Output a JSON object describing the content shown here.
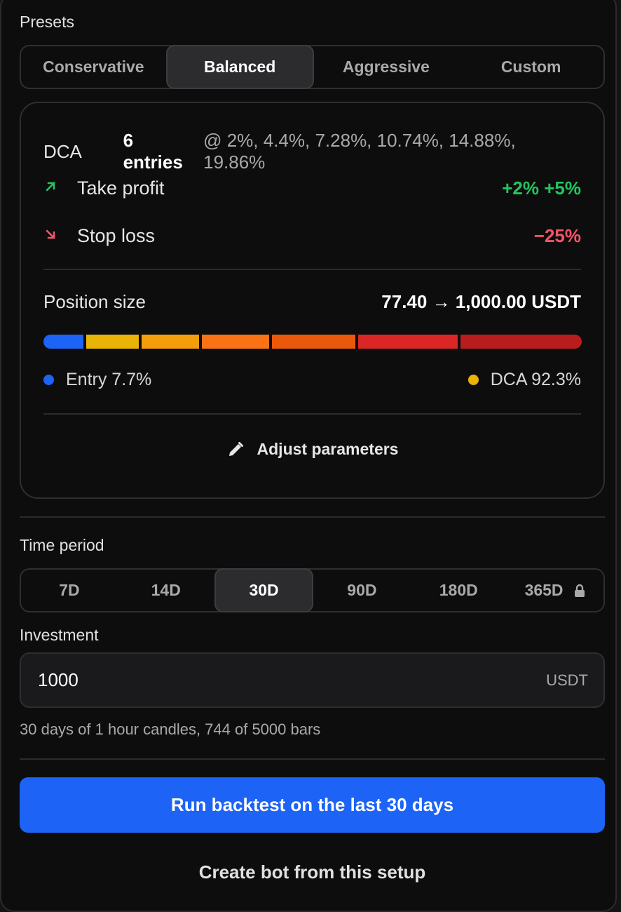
{
  "presets": {
    "label": "Presets",
    "options": [
      "Conservative",
      "Balanced",
      "Aggressive",
      "Custom"
    ],
    "selected": "Balanced"
  },
  "strategy": {
    "dca_label": "DCA",
    "dca_count": "6 entries",
    "dca_levels": "@ 2%, 4.4%, 7.28%, 10.74%, 14.88%, 19.86%",
    "take_profit_label": "Take profit",
    "take_profit_value": "+2% +5%",
    "stop_loss_label": "Stop loss",
    "stop_loss_value": "−25%",
    "position_size_label": "Position size",
    "position_size_value": "77.40 → 1,000.00 USDT",
    "allocation_segments": [
      {
        "share": 7.7,
        "color": "#1d63f5"
      },
      {
        "share": 10.0,
        "color": "#eab308"
      },
      {
        "share": 11.0,
        "color": "#f59e0b"
      },
      {
        "share": 13.0,
        "color": "#f97316"
      },
      {
        "share": 16.0,
        "color": "#ea580c"
      },
      {
        "share": 19.0,
        "color": "#dc2626"
      },
      {
        "share": 23.3,
        "color": "#b91c1c"
      }
    ],
    "entry_legend": "Entry 7.7%",
    "entry_color": "#1d63f5",
    "dca_legend": "DCA 92.3%",
    "dca_color": "#eab308",
    "adjust_label": "Adjust parameters"
  },
  "time_period": {
    "label": "Time period",
    "options": [
      "7D",
      "14D",
      "30D",
      "90D",
      "180D",
      "365D"
    ],
    "selected": "30D",
    "locked": "365D"
  },
  "investment": {
    "label": "Investment",
    "value": "1000",
    "unit": "USDT",
    "hint": "30 days of 1 hour candles, 744 of 5000 bars"
  },
  "actions": {
    "run_label": "Run backtest on the last 30 days",
    "create_label": "Create bot from this setup"
  },
  "colors": {
    "accent": "#1d63f5",
    "positive": "#22c55e",
    "negative": "#f0556a"
  }
}
